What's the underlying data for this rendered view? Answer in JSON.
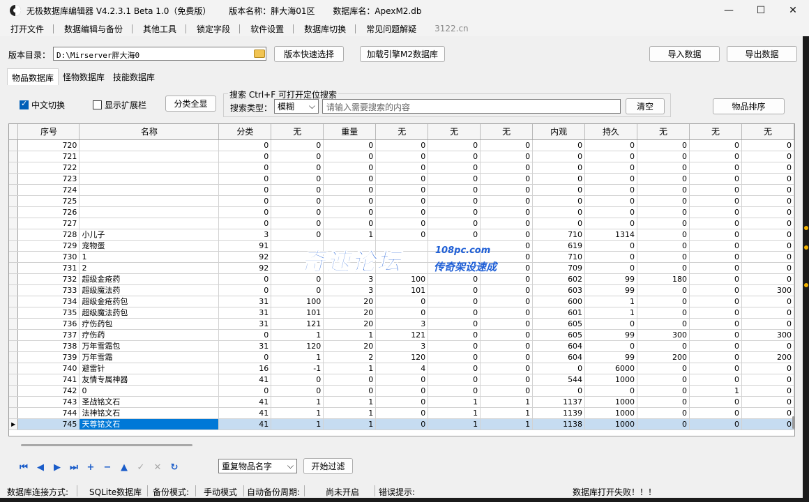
{
  "window": {
    "title_parts": [
      "无极数据库编辑器 V4.2.3.1   Beta 1.0（免费版）",
      "版本名称：胖大海01区",
      "数据库名：ApexM2.db"
    ],
    "minimize": "—",
    "maximize": "☐",
    "close": "✕"
  },
  "menu": {
    "items": [
      "打开文件",
      "数据编辑与备份",
      "其他工具",
      "锁定字段",
      "软件设置",
      "数据库切换",
      "常见问题解疑"
    ],
    "link": "3122.cn"
  },
  "dir_row": {
    "label": "版本目录：",
    "value": "D:\\Mirserver胖大海0",
    "quick_select": "版本快速选择",
    "load_engine": "加载引擎M2数据库",
    "import": "导入数据",
    "export": "导出数据"
  },
  "tabs": [
    "物品数据库",
    "怪物数据库",
    "技能数据库"
  ],
  "filters": {
    "chinese_switch": "中文切换",
    "show_ext": "显示扩展栏",
    "show_all": "分类全显",
    "search_title": "搜索  Ctrl+F 可打开定位搜索",
    "search_type_label": "搜索类型：",
    "search_type_value": "模糊",
    "search_placeholder": "请输入需要搜索的内容",
    "clear": "清空",
    "sort": "物品排序"
  },
  "grid": {
    "columns": [
      "序号",
      "名称",
      "分类",
      "无",
      "重量",
      "无",
      "无",
      "无",
      "内观",
      "持久",
      "无",
      "无",
      "无"
    ],
    "rows": [
      [
        "720",
        "",
        "0",
        "0",
        "0",
        "0",
        "0",
        "0",
        "0",
        "0",
        "0",
        "0",
        "0"
      ],
      [
        "721",
        "",
        "0",
        "0",
        "0",
        "0",
        "0",
        "0",
        "0",
        "0",
        "0",
        "0",
        "0"
      ],
      [
        "722",
        "",
        "0",
        "0",
        "0",
        "0",
        "0",
        "0",
        "0",
        "0",
        "0",
        "0",
        "0"
      ],
      [
        "723",
        "",
        "0",
        "0",
        "0",
        "0",
        "0",
        "0",
        "0",
        "0",
        "0",
        "0",
        "0"
      ],
      [
        "724",
        "",
        "0",
        "0",
        "0",
        "0",
        "0",
        "0",
        "0",
        "0",
        "0",
        "0",
        "0"
      ],
      [
        "725",
        "",
        "0",
        "0",
        "0",
        "0",
        "0",
        "0",
        "0",
        "0",
        "0",
        "0",
        "0"
      ],
      [
        "726",
        "",
        "0",
        "0",
        "0",
        "0",
        "0",
        "0",
        "0",
        "0",
        "0",
        "0",
        "0"
      ],
      [
        "727",
        "",
        "0",
        "0",
        "0",
        "0",
        "0",
        "0",
        "0",
        "0",
        "0",
        "0",
        "0"
      ],
      [
        "728",
        "小儿子",
        "3",
        "0",
        "1",
        "0",
        "0",
        "0",
        "710",
        "1314",
        "0",
        "0",
        "0"
      ],
      [
        "729",
        "宠物蛋",
        "91",
        "",
        "",
        "",
        "",
        "0",
        "619",
        "0",
        "0",
        "0",
        "0"
      ],
      [
        "730",
        "1",
        "92",
        "",
        "",
        "",
        "",
        "0",
        "710",
        "0",
        "0",
        "0",
        "0"
      ],
      [
        "731",
        "2",
        "92",
        "",
        "",
        "",
        "",
        "0",
        "709",
        "0",
        "0",
        "0",
        "0"
      ],
      [
        "732",
        "超级金疮药",
        "0",
        "0",
        "3",
        "100",
        "0",
        "0",
        "602",
        "99",
        "180",
        "0",
        "0"
      ],
      [
        "733",
        "超级魔法药",
        "0",
        "0",
        "3",
        "101",
        "0",
        "0",
        "603",
        "99",
        "0",
        "0",
        "300"
      ],
      [
        "734",
        "超级金疮药包",
        "31",
        "100",
        "20",
        "0",
        "0",
        "0",
        "600",
        "1",
        "0",
        "0",
        "0"
      ],
      [
        "735",
        "超级魔法药包",
        "31",
        "101",
        "20",
        "0",
        "0",
        "0",
        "601",
        "1",
        "0",
        "0",
        "0"
      ],
      [
        "736",
        "疗伤药包",
        "31",
        "121",
        "20",
        "3",
        "0",
        "0",
        "605",
        "0",
        "0",
        "0",
        "0"
      ],
      [
        "737",
        "疗伤药",
        "0",
        "1",
        "1",
        "121",
        "0",
        "0",
        "605",
        "99",
        "300",
        "0",
        "300"
      ],
      [
        "738",
        "万年雪霜包",
        "31",
        "120",
        "20",
        "3",
        "0",
        "0",
        "604",
        "0",
        "0",
        "0",
        "0"
      ],
      [
        "739",
        "万年雪霜",
        "0",
        "1",
        "2",
        "120",
        "0",
        "0",
        "604",
        "99",
        "200",
        "0",
        "200"
      ],
      [
        "740",
        "避雷针",
        "16",
        "-1",
        "1",
        "4",
        "0",
        "0",
        "0",
        "6000",
        "0",
        "0",
        "0"
      ],
      [
        "741",
        "友情专属神器",
        "41",
        "0",
        "0",
        "0",
        "0",
        "0",
        "544",
        "1000",
        "0",
        "0",
        "0"
      ],
      [
        "742",
        "0",
        "0",
        "0",
        "0",
        "0",
        "0",
        "0",
        "0",
        "0",
        "0",
        "1",
        "0"
      ],
      [
        "743",
        "圣战铭文石",
        "41",
        "1",
        "1",
        "0",
        "1",
        "1",
        "1137",
        "1000",
        "0",
        "0",
        "0"
      ],
      [
        "744",
        "法神铭文石",
        "41",
        "1",
        "1",
        "0",
        "1",
        "1",
        "1139",
        "1000",
        "0",
        "0",
        "0"
      ],
      [
        "745",
        "天尊铭文石",
        "41",
        "1",
        "1",
        "0",
        "1",
        "1",
        "1138",
        "1000",
        "0",
        "0",
        "0"
      ]
    ],
    "selected_row_index": 25,
    "current_marker": "▶"
  },
  "watermark": {
    "main": "奇速论坛",
    "url": "108pc.com",
    "sub": "传奇架设速成"
  },
  "navigator": {
    "icons": [
      "first-icon",
      "prior-icon",
      "next-icon",
      "last-icon",
      "insert-icon",
      "delete-icon",
      "edit-icon",
      "post-icon",
      "cancel-icon",
      "refresh-icon"
    ],
    "glyphs": [
      "⏮",
      "◀",
      "▶",
      "⏭",
      "+",
      "−",
      "▲",
      "✓",
      "✕",
      "↻"
    ]
  },
  "filter_row": {
    "dup_select": "重复物品名字",
    "start_filter": "开始过滤"
  },
  "status": {
    "conn_label": "数据库连接方式:",
    "conn_value": "SQLite数据库",
    "backup_label": "备份模式:",
    "backup_value": "手动模式",
    "auto_label": "自动备份周期:",
    "auto_value": "尚未开启",
    "error_label": "错误提示:",
    "error_value": "数据库打开失败！！！"
  }
}
